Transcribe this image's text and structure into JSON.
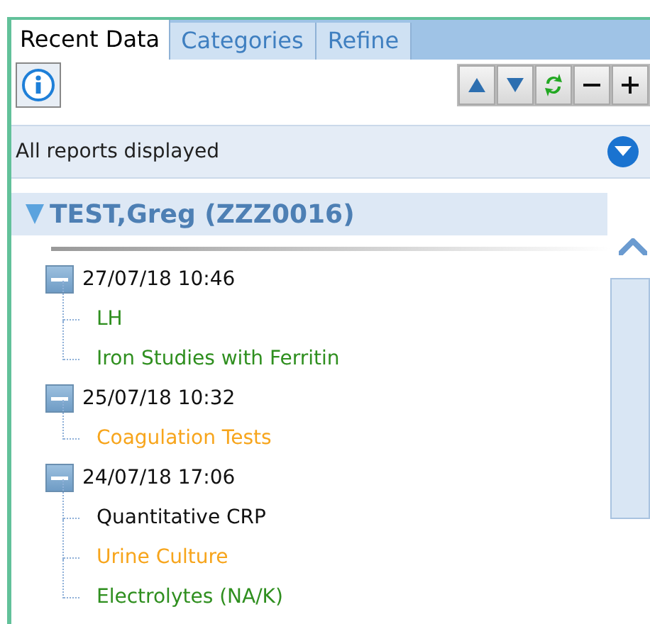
{
  "tabs": [
    {
      "label": "Recent Data",
      "selected": true
    },
    {
      "label": "Categories",
      "selected": false
    },
    {
      "label": "Refine",
      "selected": false
    }
  ],
  "filter": {
    "text": "All reports displayed"
  },
  "patient": {
    "name": "TEST,Greg (ZZZ0016)",
    "expanded": true
  },
  "groups": [
    {
      "date": "27/07/18 10:46",
      "expanded": true,
      "children": [
        {
          "label": "LH",
          "color": "#2f8f1f"
        },
        {
          "label": "Iron Studies with Ferritin",
          "color": "#2f8f1f"
        }
      ]
    },
    {
      "date": "25/07/18 10:32",
      "expanded": true,
      "children": [
        {
          "label": "Coagulation Tests",
          "color": "#f7a51c"
        }
      ]
    },
    {
      "date": "24/07/18 17:06",
      "expanded": true,
      "children": [
        {
          "label": "Quantitative CRP",
          "color": "#111111"
        },
        {
          "label": "Urine Culture",
          "color": "#f7a51c"
        },
        {
          "label": "Electrolytes (NA/K)",
          "color": "#2f8f1f"
        }
      ]
    }
  ]
}
